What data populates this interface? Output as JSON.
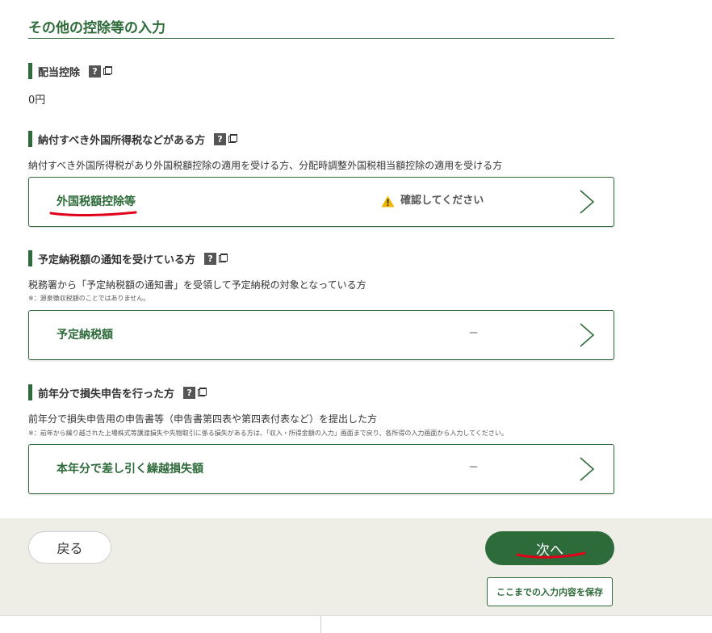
{
  "page": {
    "title": "その他の控除等の入力"
  },
  "sections": {
    "dividend": {
      "heading": "配当控除",
      "help_icon": "?",
      "amount": "0円"
    },
    "foreign_tax": {
      "heading": "納付すべき外国所得税などがある方",
      "help_icon": "?",
      "description": "納付すべき外国所得税があり外国税額控除の適用を受ける方、分配時調整外国税相当額控除の適用を受ける方",
      "item": {
        "label": "外国税額控除等",
        "status": "確認してください",
        "status_icon": "warning-icon"
      }
    },
    "scheduled_tax": {
      "heading": "予定納税額の通知を受けている方",
      "help_icon": "?",
      "description": "税務署から「予定納税額の通知書」を受領して予定納税の対象となっている方",
      "note": "※：源泉徴収税額のことではありません。",
      "item": {
        "label": "予定納税額",
        "status": "－"
      }
    },
    "loss_carryover": {
      "heading": "前年分で損失申告を行った方",
      "help_icon": "?",
      "description": "前年分で損失申告用の申告書等（申告書第四表や第四表付表など）を提出した方",
      "note": "※：前年から繰り越された上場株式等譲渡損失や先物取引に係る損失がある方は、「収入・所得金額の入力」画面まで戻り、各所得の入力画面から入力してください。",
      "item": {
        "label": "本年分で差し引く繰越損失額",
        "status": "－"
      }
    }
  },
  "footer": {
    "back_label": "戻る",
    "next_label": "次へ",
    "save_label": "ここまでの入力内容を保存"
  },
  "colors": {
    "accent": "#2e6b3a",
    "footer_bg": "#eeede6",
    "warning": "#f0b400",
    "annotation": "#e0001b"
  }
}
